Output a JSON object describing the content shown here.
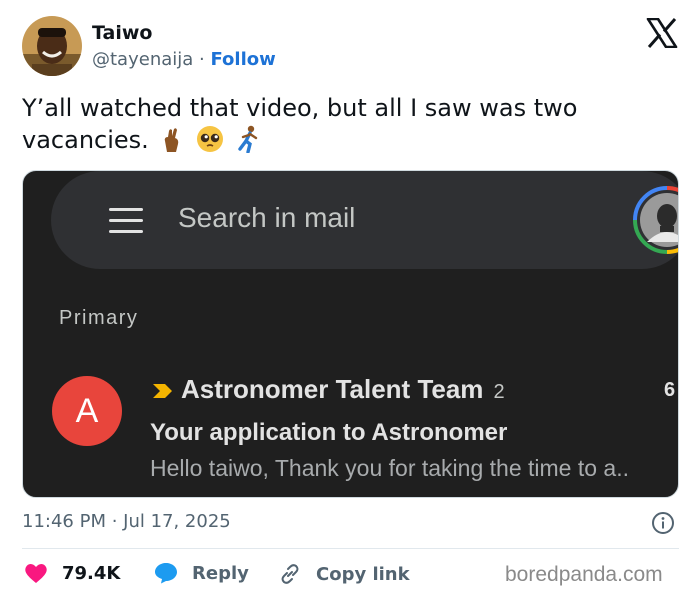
{
  "tweet": {
    "author_name": "Taiwo",
    "author_handle": "@tayenaija",
    "separator": " · ",
    "follow_label": "Follow",
    "text": "Y’all watched that video, but all I saw was two vacancies.",
    "emojis": [
      "crossed-fingers",
      "pleading-face",
      "running-man"
    ],
    "timestamp": "11:46 PM · Jul 17, 2025"
  },
  "gmail": {
    "search_placeholder": "Search in mail",
    "section_label": "Primary",
    "email": {
      "avatar_letter": "A",
      "avatar_color": "#e8453c",
      "sender": "Astronomer Talent Team",
      "thread_count": "2",
      "time_partial": "6",
      "subject": "Your application to Astronomer",
      "snippet": "Hello taiwo, Thank you for taking the time to a..",
      "importance_color": "#f4b400"
    }
  },
  "actions": {
    "likes": "79.4K",
    "reply": "Reply",
    "copy_link": "Copy link"
  },
  "watermark": "boredpanda.com",
  "colors": {
    "follow": "#1d72d6",
    "like_heart": "#f91880",
    "reply_bubble": "#1d9bf0",
    "media_bg": "#1f1f1f"
  }
}
